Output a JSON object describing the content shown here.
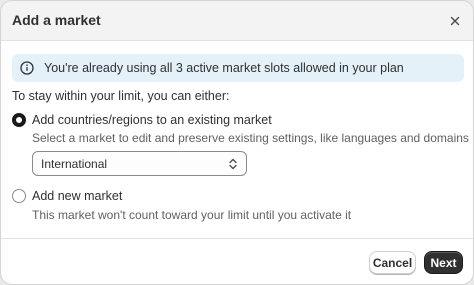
{
  "dialog": {
    "title": "Add a market",
    "close_icon": "close-icon"
  },
  "banner": {
    "icon": "info-icon",
    "text": "You're already using all 3 active market slots allowed in your plan",
    "color": "#e5f1f9"
  },
  "intro": "To stay within your limit, you can either:",
  "options": [
    {
      "label": "Add countries/regions to an existing market",
      "description": "Select a market to edit and preserve existing settings, like languages and domains",
      "selected": true
    },
    {
      "label": "Add new market",
      "description": "This market won't count toward your limit until you activate it",
      "selected": false
    }
  ],
  "market_select": {
    "value": "International",
    "icon": "chevron-updown-icon"
  },
  "footer": {
    "cancel_label": "Cancel",
    "next_label": "Next",
    "primary_color": "#303030"
  }
}
